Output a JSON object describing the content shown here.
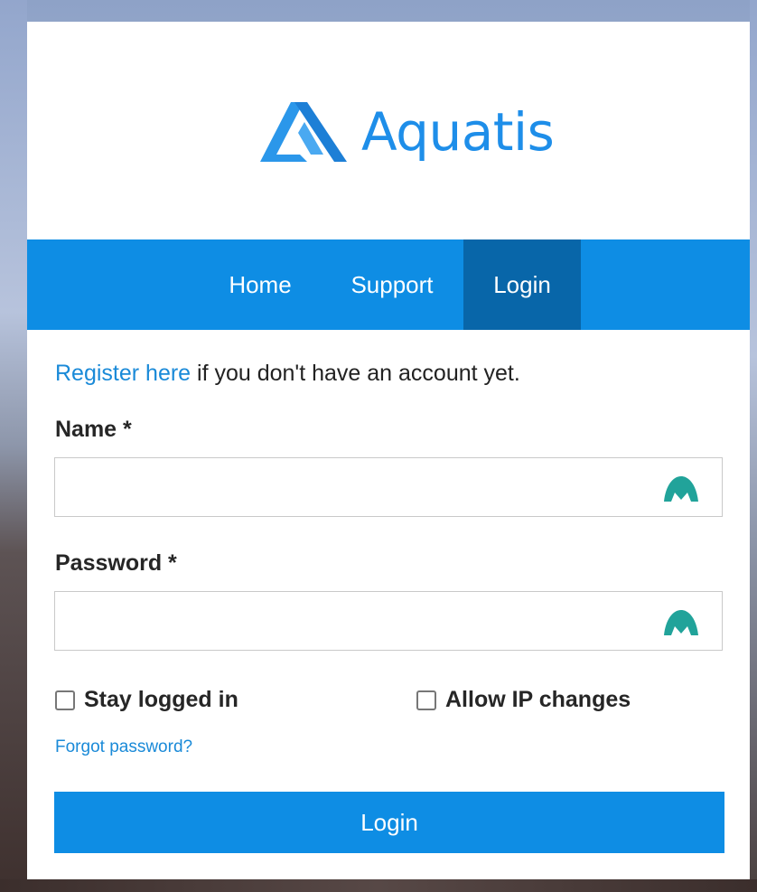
{
  "brand": {
    "name": "Aquatis",
    "color": "#1e8ee9",
    "logo_icon": "triangle-logo-icon"
  },
  "nav": {
    "items": [
      {
        "label": "Home",
        "active": false
      },
      {
        "label": "Support",
        "active": false
      },
      {
        "label": "Login",
        "active": true
      }
    ],
    "bg_color": "#0e8de4",
    "active_color": "#0866a9"
  },
  "register": {
    "link_text": "Register here",
    "rest_text": " if you don't have an account yet."
  },
  "form": {
    "name_label": "Name *",
    "name_value": "",
    "password_label": "Password *",
    "password_value": "",
    "password_manager_icon": "password-manager-icon",
    "stay_logged_in_label": "Stay logged in",
    "stay_logged_in_checked": false,
    "allow_ip_label": "Allow IP changes",
    "allow_ip_checked": false,
    "forgot_label": "Forgot password?",
    "submit_label": "Login"
  }
}
